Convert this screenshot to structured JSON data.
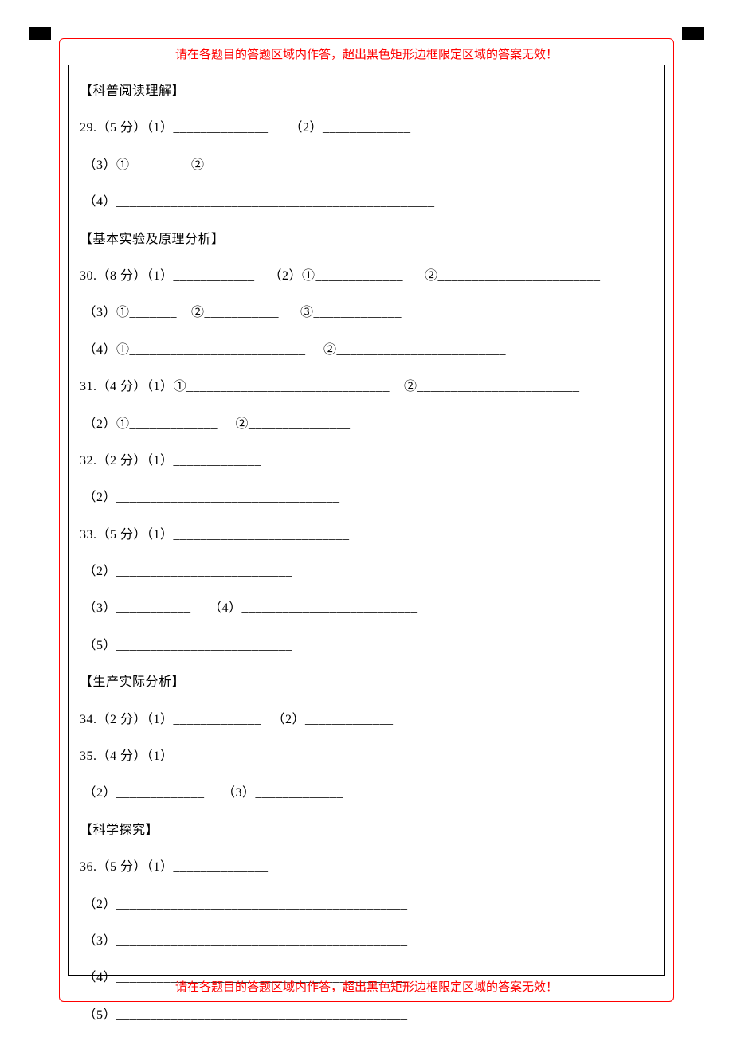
{
  "warnings": {
    "top": "请在各题目的答题区域内作答，超出黑色矩形边框限定区域的答案无效！",
    "bottom": "请在各题目的答题区域内作答，超出黑色矩形边框限定区域的答案无效！"
  },
  "sections": {
    "s1": "【科普阅读理解】",
    "s2": "【基本实验及原理分析】",
    "s3": "【生产实际分析】",
    "s4": "【科学探究】"
  },
  "lines": {
    "q29_1": "29.（5 分）（1）______________      （2）_____________",
    "q29_2": " （3）①_______    ②_______",
    "q29_3": " （4）_______________________________________________",
    "q30_1": "30.（8 分）（1）____________    （2）①_____________      ②________________________",
    "q30_2": " （3）①_______    ②___________      ③_____________",
    "q30_3": " （4）①__________________________     ②_________________________",
    "q31_1": "31.（4 分）（1）①______________________________    ②________________________",
    "q31_2": " （2）①_____________     ②_______________",
    "q32_1": "32.（2 分）（1）_____________",
    "q32_2": " （2）_________________________________",
    "q33_1": "33.（5 分）（1）__________________________",
    "q33_2": " （2）__________________________",
    "q33_3": " （3）___________     （4）__________________________",
    "q33_4": " （5）__________________________",
    "q34_1": "34.（2 分）（1）_____________   （2）_____________",
    "q35_1": "35.（4 分）（1）_____________        _____________",
    "q35_2": " （2）_____________     （3）_____________",
    "q36_1": "36.（5 分）（1）______________",
    "q36_2": " （2）___________________________________________",
    "q36_3": " （3）___________________________________________",
    "q36_4": " （4）___________________________________________",
    "q36_5": " （5）___________________________________________"
  }
}
